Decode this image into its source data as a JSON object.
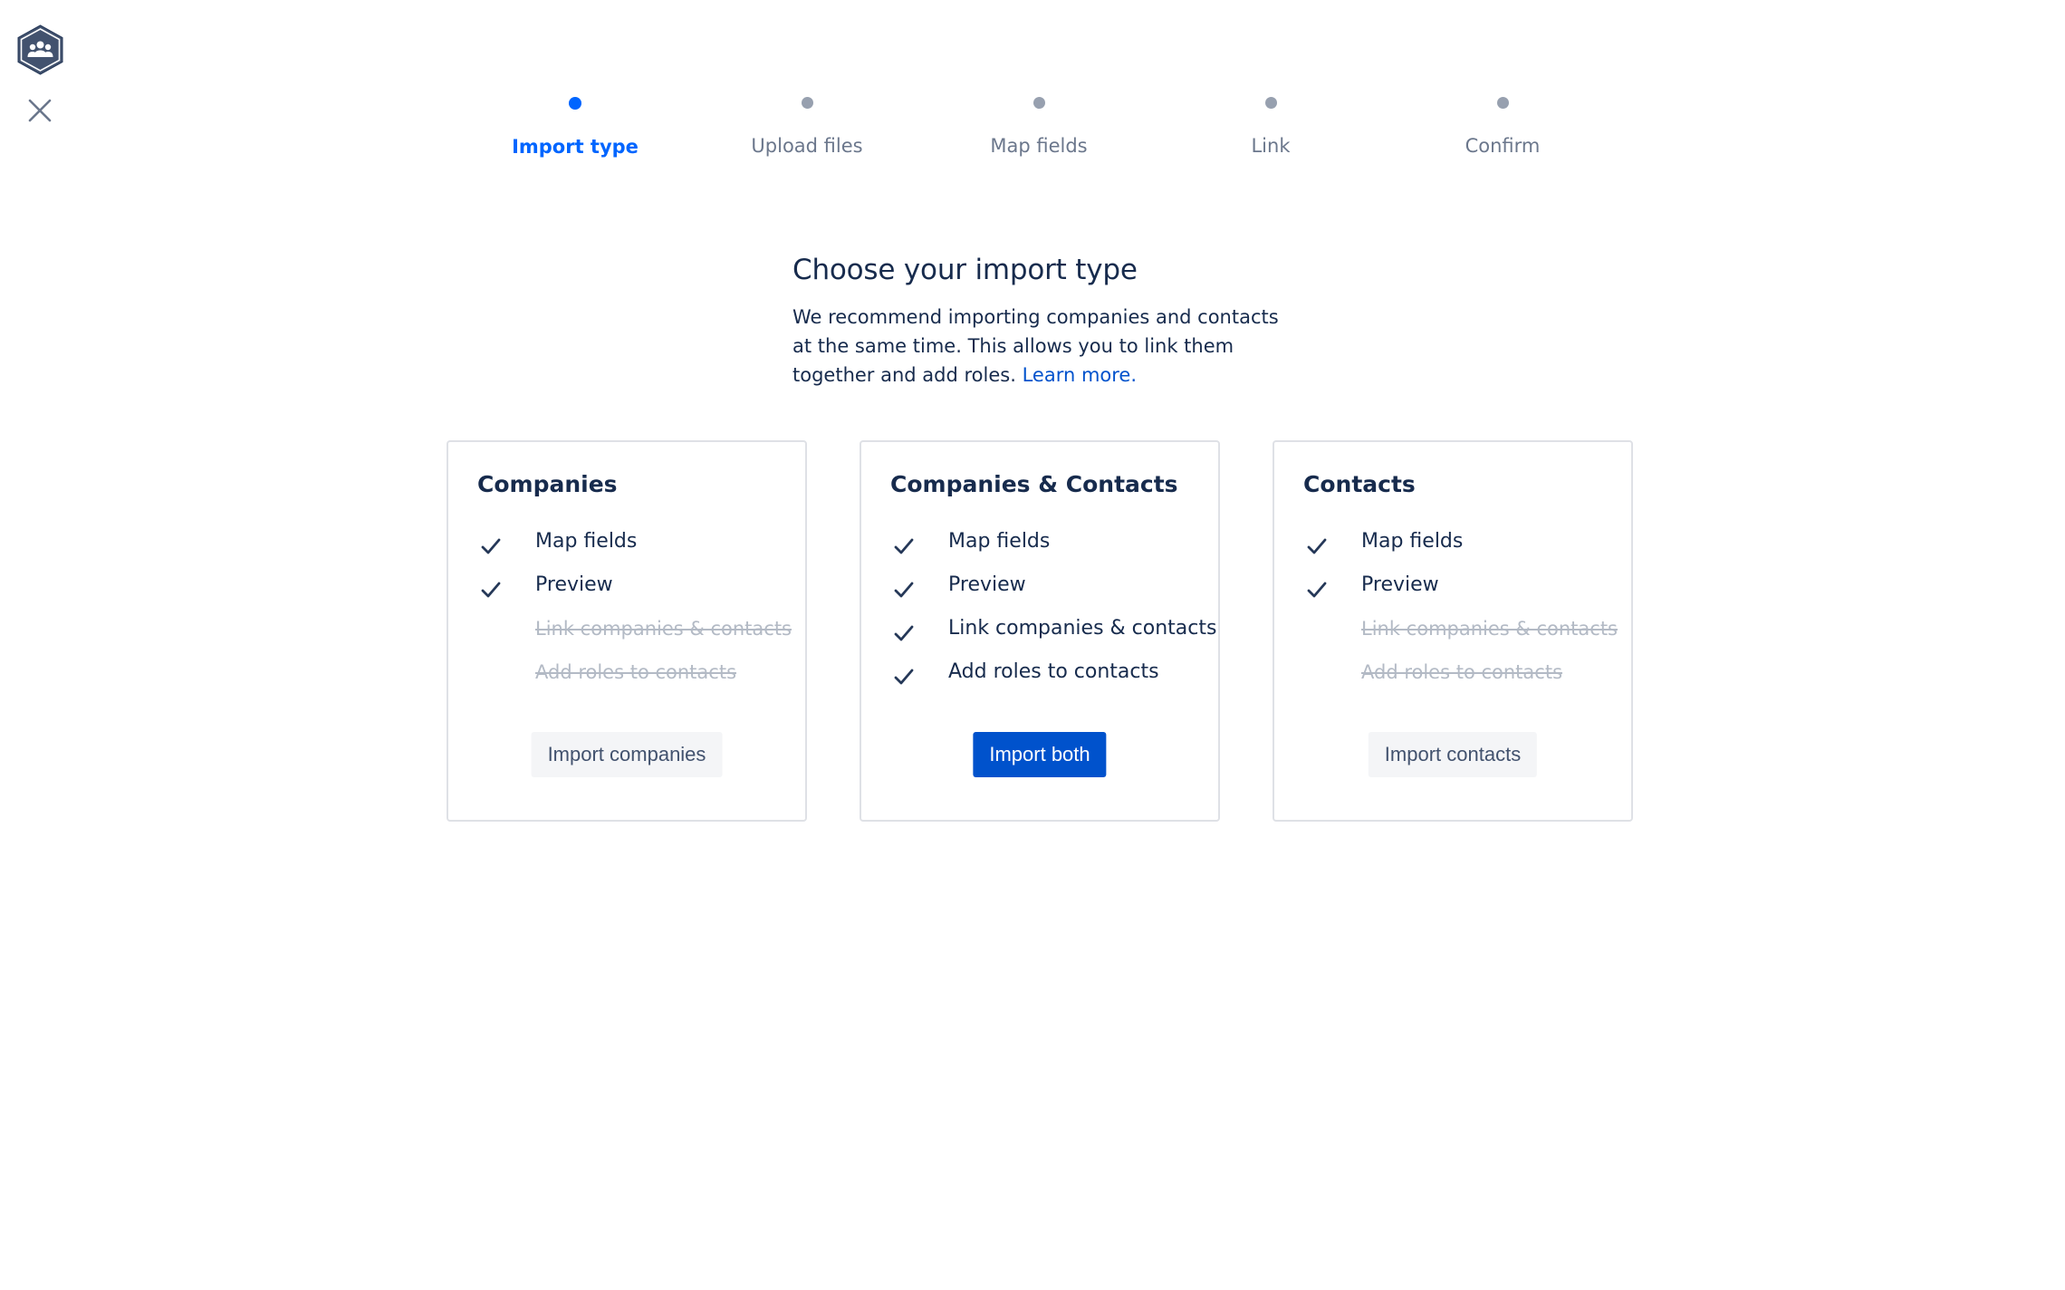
{
  "colors": {
    "primary": "#0052cc",
    "active_step": "#0065ff",
    "inactive_step": "#97a0af",
    "text": "#172b4d",
    "disabled_text": "#b3bac5",
    "card_border": "#dfe1e6"
  },
  "app": {
    "logo_icon": "team-hexagon-icon",
    "close_icon": "close-icon"
  },
  "stepper": {
    "steps": [
      {
        "label": "Import type",
        "active": true
      },
      {
        "label": "Upload files",
        "active": false
      },
      {
        "label": "Map fields",
        "active": false
      },
      {
        "label": "Link",
        "active": false
      },
      {
        "label": "Confirm",
        "active": false
      }
    ]
  },
  "intro": {
    "title": "Choose your import type",
    "description": "We recommend importing companies and contacts at the same time. This allows you to link them together and add roles.",
    "learn_more": "Learn more."
  },
  "cards": [
    {
      "title": "Companies",
      "features": [
        {
          "label": "Map fields",
          "included": true
        },
        {
          "label": "Preview",
          "included": true
        },
        {
          "label": "Link companies & contacts",
          "included": false
        },
        {
          "label": "Add roles to contacts",
          "included": false
        }
      ],
      "button": "Import companies",
      "primary": false
    },
    {
      "title": "Companies & Contacts",
      "features": [
        {
          "label": "Map fields",
          "included": true
        },
        {
          "label": "Preview",
          "included": true
        },
        {
          "label": "Link companies & contacts",
          "included": true
        },
        {
          "label": "Add roles to contacts",
          "included": true
        }
      ],
      "button": "Import both",
      "primary": true
    },
    {
      "title": "Contacts",
      "features": [
        {
          "label": "Map fields",
          "included": true
        },
        {
          "label": "Preview",
          "included": true
        },
        {
          "label": "Link companies & contacts",
          "included": false
        },
        {
          "label": "Add roles to contacts",
          "included": false
        }
      ],
      "button": "Import contacts",
      "primary": false
    }
  ]
}
